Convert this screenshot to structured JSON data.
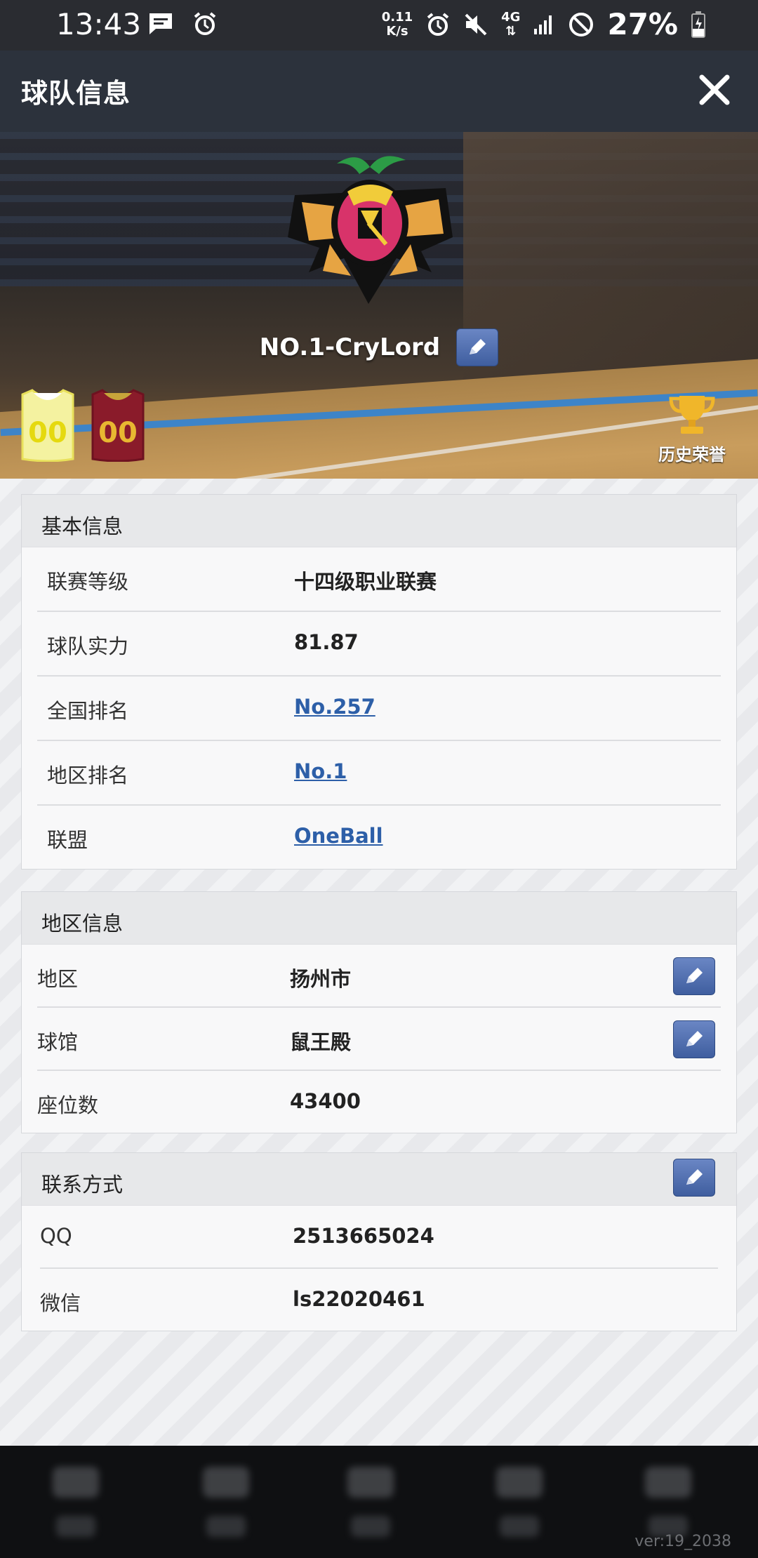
{
  "status_bar": {
    "time": "13:43",
    "net_speed_value": "0.11",
    "net_speed_unit": "K/s",
    "network_type": "4G",
    "battery": "27%"
  },
  "header": {
    "title": "球队信息"
  },
  "hero": {
    "team_name": "NO.1-CryLord",
    "home_jersey_number": "00",
    "away_jersey_number": "00",
    "honor_label": "历史荣誉"
  },
  "basic_info": {
    "title": "基本信息",
    "rows": [
      {
        "label": "联赛等级",
        "value": "十四级职业联赛"
      },
      {
        "label": "球队实力",
        "value": "81.87"
      },
      {
        "label": "全国排名",
        "value": "No.257"
      },
      {
        "label": "地区排名",
        "value": "No.1"
      },
      {
        "label": "联盟",
        "value": "OneBall"
      }
    ]
  },
  "region_info": {
    "title": "地区信息",
    "rows": [
      {
        "label": "地区",
        "value": "扬州市"
      },
      {
        "label": "球馆",
        "value": "鼠王殿"
      },
      {
        "label": "座位数",
        "value": "43400"
      }
    ]
  },
  "contact": {
    "title": "联系方式",
    "rows": [
      {
        "label": "QQ",
        "value": "2513665024"
      },
      {
        "label": "微信",
        "value": "ls22020461"
      }
    ]
  },
  "footer": {
    "version": "ver:19_2038"
  },
  "colors": {
    "header_bg": "#2c323c",
    "link": "#2d5fa8",
    "edit_button": "#4f6fb0",
    "home_jersey": "#f4f2a0",
    "away_jersey": "#8a1b2a"
  }
}
